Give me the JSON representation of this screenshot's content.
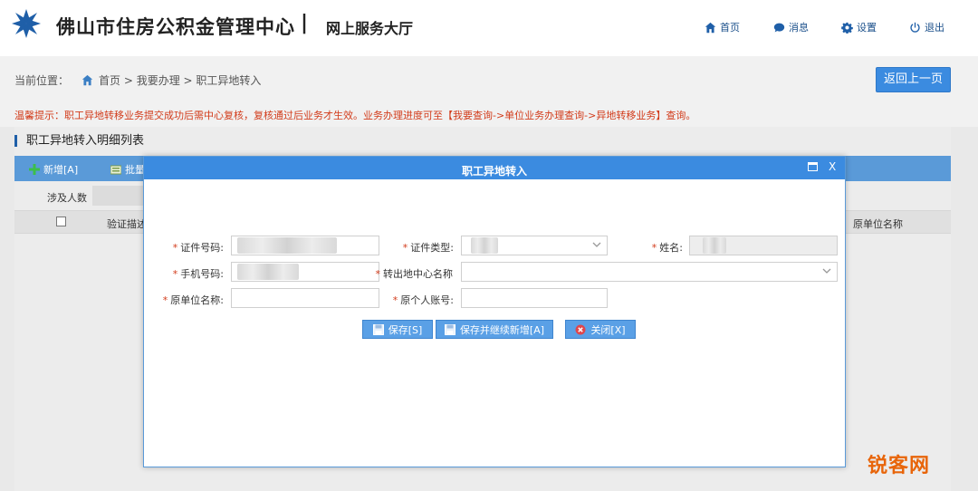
{
  "header": {
    "org_name": "佛山市住房公积金管理中心",
    "separator": "|",
    "portal_name": "网上服务大厅",
    "nav": [
      {
        "icon": "home-icon",
        "label": "首页"
      },
      {
        "icon": "message-icon",
        "label": "消息"
      },
      {
        "icon": "gear-icon",
        "label": "设置"
      },
      {
        "icon": "power-icon",
        "label": "退出"
      }
    ]
  },
  "breadcrumb": {
    "prefix": "当前位置：",
    "path": "首页 > 我要办理 > 职工异地转入"
  },
  "back_button": "返回上一页",
  "tip": "温馨提示：职工异地转移业务提交成功后需中心复核，复核通过后业务才生效。业务办理进度可至【我要查询->单位业务办理查询->异地转移业务】查询。",
  "list": {
    "title": "职工异地转入明细列表",
    "toolbar": {
      "add": "新增[A]",
      "batch": "批量"
    },
    "filter_label": "涉及人数",
    "columns": {
      "verify": "验证描述",
      "orig_unit": "原单位名称"
    }
  },
  "modal": {
    "title": "职工异地转入",
    "close": "X",
    "required_mark": "*",
    "fields": {
      "id_number": {
        "label": "证件号码:",
        "value": ""
      },
      "id_type": {
        "label": "证件类型:",
        "value": ""
      },
      "name": {
        "label": "姓名:",
        "value": ""
      },
      "phone": {
        "label": "手机号码:",
        "value": ""
      },
      "transfer_center": {
        "label": "转出地中心名称",
        "value": ""
      },
      "orig_unit": {
        "label": "原单位名称:",
        "value": ""
      },
      "orig_account": {
        "label": "原个人账号:",
        "value": ""
      }
    },
    "buttons": {
      "save": "保存[S]",
      "save_add": "保存并继续新增[A]",
      "close": "关闭[X]"
    }
  },
  "watermark": "锐客网",
  "colors": {
    "primary": "#3b8be0",
    "required": "#d23b1a",
    "watermark": "#e8650a"
  }
}
